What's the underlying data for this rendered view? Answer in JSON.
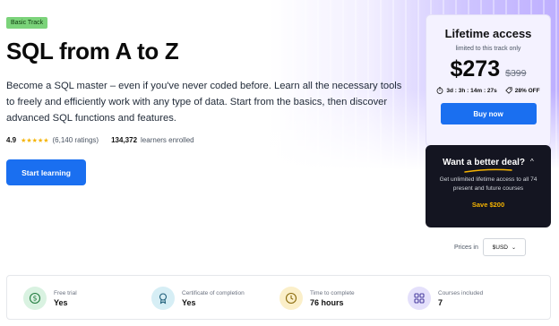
{
  "hero": {
    "badge": "Basic Track",
    "title": "SQL from A to Z",
    "description": "Become a SQL master – even if you've never coded before. Learn all the necessary tools to freely and efficiently work with any type of data. Start from the basics, then discover advanced SQL functions and features.",
    "rating": "4.9",
    "stars": "★★★★★",
    "ratings_count": "(6,140 ratings)",
    "learners_count": "134,372",
    "learners_label": "learners enrolled",
    "cta_label": "Start learning"
  },
  "pricing": {
    "title": "Lifetime access",
    "subtitle": "limited to this track only",
    "price": "$273",
    "old_price": "$399",
    "timer": "3d : 3h : 14m : 27s",
    "discount": "28% OFF",
    "buy_label": "Buy now"
  },
  "deal": {
    "title": "Want a better deal?",
    "chevron": "^",
    "description": "Get unlimited lifetime access to all 74 present and future courses",
    "save_label": "Save $200"
  },
  "currency": {
    "label": "Prices in",
    "selected": "$USD"
  },
  "info": {
    "items": [
      {
        "label": "Free trial",
        "value": "Yes",
        "icon": "dollar-icon",
        "color": "#d9f2e1"
      },
      {
        "label": "Certificate of completion",
        "value": "Yes",
        "icon": "certificate-icon",
        "color": "#d6eef5"
      },
      {
        "label": "Time to complete",
        "value": "76 hours",
        "icon": "clock-icon",
        "color": "#fbefc9"
      },
      {
        "label": "Courses included",
        "value": "7",
        "icon": "grid-icon",
        "color": "#e4e0fb"
      }
    ]
  },
  "colors": {
    "accent": "#1a6ff0",
    "badge": "#7bd37a",
    "deal_bg": "#141521",
    "deal_highlight": "#f5b301",
    "card_bg": "#f4f2ff"
  }
}
